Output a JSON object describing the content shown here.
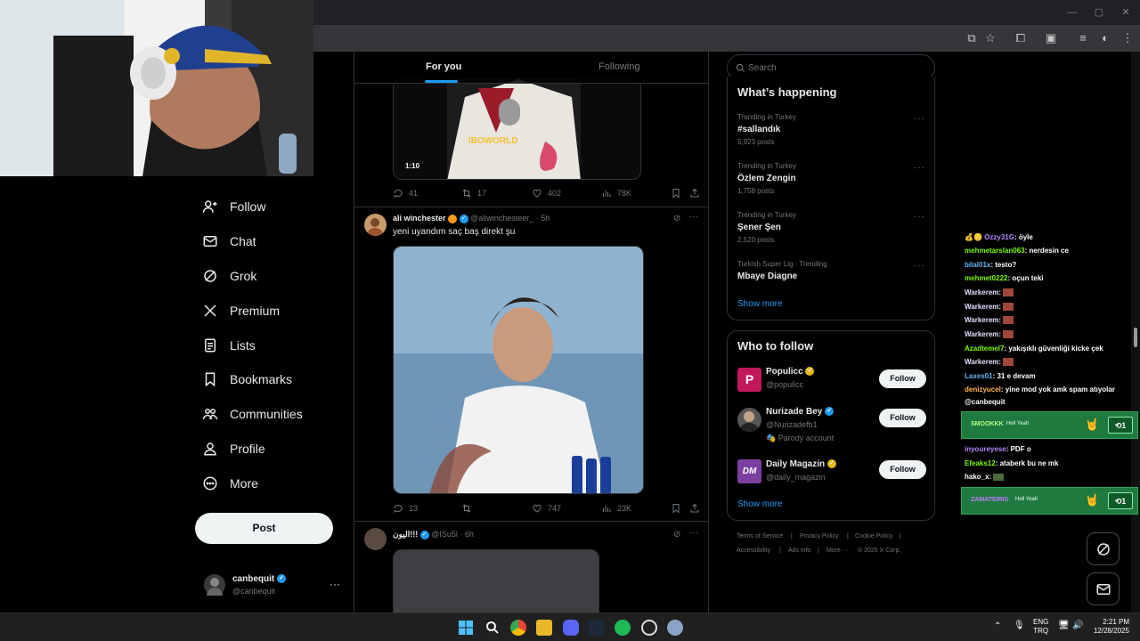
{
  "nav": {
    "items": [
      {
        "label": "Follow",
        "icon": "add-person-icon"
      },
      {
        "label": "Chat",
        "icon": "envelope-icon"
      },
      {
        "label": "Grok",
        "icon": "grok-icon"
      },
      {
        "label": "Premium",
        "icon": "x-logo-icon"
      },
      {
        "label": "Lists",
        "icon": "list-icon"
      },
      {
        "label": "Bookmarks",
        "icon": "bookmark-icon"
      },
      {
        "label": "Communities",
        "icon": "communities-icon"
      },
      {
        "label": "Profile",
        "icon": "person-icon"
      },
      {
        "label": "More",
        "icon": "more-circle-icon"
      }
    ],
    "post_label": "Post",
    "account": {
      "name": "canbequit",
      "handle": "@canbequit"
    }
  },
  "tabs": {
    "for_you": "For you",
    "following": "Following"
  },
  "tweets": [
    {
      "video_time": "1:10",
      "watermark": "IBOWORLD",
      "stats": {
        "replies": "41",
        "reposts": "17",
        "likes": "402",
        "views": "78K"
      }
    },
    {
      "name": "ali winchester",
      "handle": "@aliwinchesteer_",
      "time": "· 5h",
      "text": "yeni uyandım saç baş direkt şu",
      "stats": {
        "replies": "13",
        "reposts": "",
        "likes": "747",
        "views": "23K"
      }
    },
    {
      "name": "الیون!!!",
      "handle": "@ISu5l",
      "time": "· 6h"
    }
  ],
  "search": {
    "placeholder": "Search"
  },
  "trending": {
    "title": "What’s happening",
    "items": [
      {
        "meta": "Trending in Turkey",
        "name": "#sallandık",
        "count": "5,923 posts"
      },
      {
        "meta": "Trending in Turkey",
        "name": "Özlem Zengin",
        "count": "1,758 posts"
      },
      {
        "meta": "Trending in Turkey",
        "name": "Şener Şen",
        "count": "2,520 posts"
      },
      {
        "meta": "Turkish Super Lig · Trending",
        "name": "Mbaye Diagne",
        "count": ""
      }
    ],
    "show_more": "Show more"
  },
  "who_to_follow": {
    "title": "Who to follow",
    "users": [
      {
        "name": "Populicc",
        "handle": "@populicc",
        "note": "",
        "avatar_color": "#c2185b",
        "badge": "gold"
      },
      {
        "name": "Nurizade Bey",
        "handle": "@Nurizadefb1",
        "note": "Parody account",
        "avatar_color": "#555555",
        "badge": "blue"
      },
      {
        "name": "Daily Magazin",
        "handle": "@daily_magazin",
        "note": "",
        "avatar_color": "#7b3fa0",
        "badge": "gold"
      }
    ],
    "follow_label": "Follow",
    "show_more": "Show more"
  },
  "footer": {
    "links": [
      "Terms of Service",
      "Privacy Policy",
      "Cookie Policy",
      "Accessibility",
      "Ads info",
      "More ···",
      "© 2025 X Corp."
    ]
  },
  "chat": {
    "messages": [
      {
        "user": "Ozzy31G",
        "text": ": öyle",
        "color": "#b388ff"
      },
      {
        "user": "mehmetarslan063",
        "text": ": nerdesin ce",
        "color": "#7cfc00"
      },
      {
        "user": "bilal01x",
        "text": ": testo?",
        "color": "#64b5f6"
      },
      {
        "user": "mehmet0222",
        "text": ": oçun teki",
        "color": "#7cfc00"
      },
      {
        "user": "Warkerem",
        "text": ":",
        "color": "#e0e0ff"
      },
      {
        "user": "Warkerem",
        "text": ":",
        "color": "#e0e0ff"
      },
      {
        "user": "Warkerem",
        "text": ":",
        "color": "#e0e0ff"
      },
      {
        "user": "Warkerem",
        "text": ":",
        "color": "#e0e0ff"
      },
      {
        "user": "Azadtemel7",
        "text": ": yakışıklı güvenliği kicke çek",
        "color": "#7cfc00"
      },
      {
        "user": "Warkerem",
        "text": ":",
        "color": "#e0e0ff"
      },
      {
        "user": "Laxes01",
        "text": ": 31 e devam",
        "color": "#64b5f6"
      },
      {
        "user": "denizyucel",
        "text": ": yine mod yok amk spam atıyolar",
        "color": "#ffb74d"
      },
      {
        "user": "",
        "text": "@canbequit",
        "color": "#ffffff"
      }
    ],
    "banner1": {
      "user": "SMOOKKK",
      "text": "Hell Yeah",
      "count": "1"
    },
    "messages2": [
      {
        "user": "inyoureyese",
        "text": ": PDF o",
        "color": "#b388ff"
      },
      {
        "user": "Efeaks12",
        "text": ": ataberk bu ne mk",
        "color": "#7cfc00"
      },
      {
        "user": "hako_x",
        "text": ":",
        "color": "#ffffff"
      }
    ],
    "banner2": {
      "user": "ZAMATEIRIS",
      "text": "Hell Yeah",
      "count": "1"
    }
  },
  "taskbar": {
    "lang": "ENG",
    "lang2": "TRQ",
    "time": "2:21 PM",
    "date": "12/28/2025"
  },
  "colors": {
    "accent": "#1d9bf0",
    "bg": "#000000",
    "text": "#e7e9ea",
    "muted": "#71767b"
  }
}
